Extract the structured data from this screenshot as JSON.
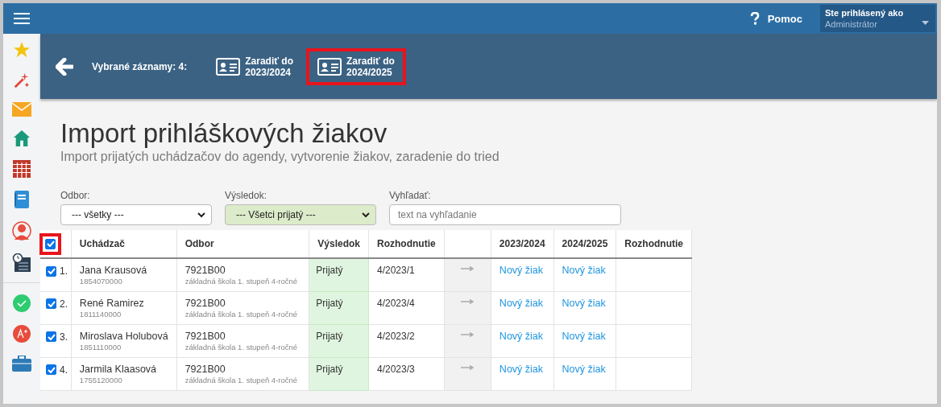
{
  "topbar": {
    "help": "Pomoc",
    "user_label": "Ste prihlásený ako",
    "user_name": "Administrátor"
  },
  "action_bar": {
    "selected_count": "Vybrané záznamy: 4:",
    "buttons": [
      {
        "label": "Zaradiť do",
        "year": "2023/2024",
        "highlighted": false
      },
      {
        "label": "Zaradiť do",
        "year": "2024/2025",
        "highlighted": true
      }
    ]
  },
  "page": {
    "title": "Import prihláškových žiakov",
    "subtitle": "Import prijatých uchádzačov do agendy, vytvorenie žiakov, zaradenie do tried"
  },
  "filters": [
    {
      "kind": "select",
      "label": "Odbor:",
      "value": "--- všetky ---",
      "active": false
    },
    {
      "kind": "select",
      "label": "Výsledok:",
      "value": "--- Všetci prijatý ---",
      "active": true
    },
    {
      "kind": "search",
      "label": "Vyhľadať:",
      "placeholder": "text na vyhľadanie"
    }
  ],
  "table": {
    "select_all": {
      "checked": true,
      "highlighted": true
    },
    "columns": [
      "Uchádzač",
      "Odbor",
      "Výsledok",
      "Rozhodnutie",
      "2023/2024",
      "2024/2025",
      "Rozhodnutie"
    ],
    "rows": [
      {
        "checked": true,
        "number": "1.",
        "name": "Jana Krausová",
        "id": "1854070000",
        "code": "7921B00",
        "program": "základná škola 1. stupeň 4-ročné",
        "result": "Prijatý",
        "decision": "4/2023/1",
        "year_1": "Nový žiak",
        "year_2": "Nový žiak"
      },
      {
        "checked": true,
        "number": "2.",
        "name": "René Ramirez",
        "id": "1811140000",
        "code": "7921B00",
        "program": "základná škola 1. stupeň 4-ročné",
        "result": "Prijatý",
        "decision": "4/2023/4",
        "year_1": "Nový žiak",
        "year_2": "Nový žiak"
      },
      {
        "checked": true,
        "number": "3.",
        "name": "Miroslava Holubová",
        "id": "1851110000",
        "code": "7921B00",
        "program": "základná škola 1. stupeň 4-ročné",
        "result": "Prijatý",
        "decision": "4/2023/2",
        "year_1": "Nový žiak",
        "year_2": "Nový žiak"
      },
      {
        "checked": true,
        "number": "4.",
        "name": "Jarmila Klaasová",
        "id": "1755120000",
        "code": "7921B00",
        "program": "základná škola 1. stupeň 4-ročné",
        "result": "Prijatý",
        "decision": "4/2023/3",
        "year_1": "Nový žiak",
        "year_2": "Nový žiak"
      }
    ]
  }
}
